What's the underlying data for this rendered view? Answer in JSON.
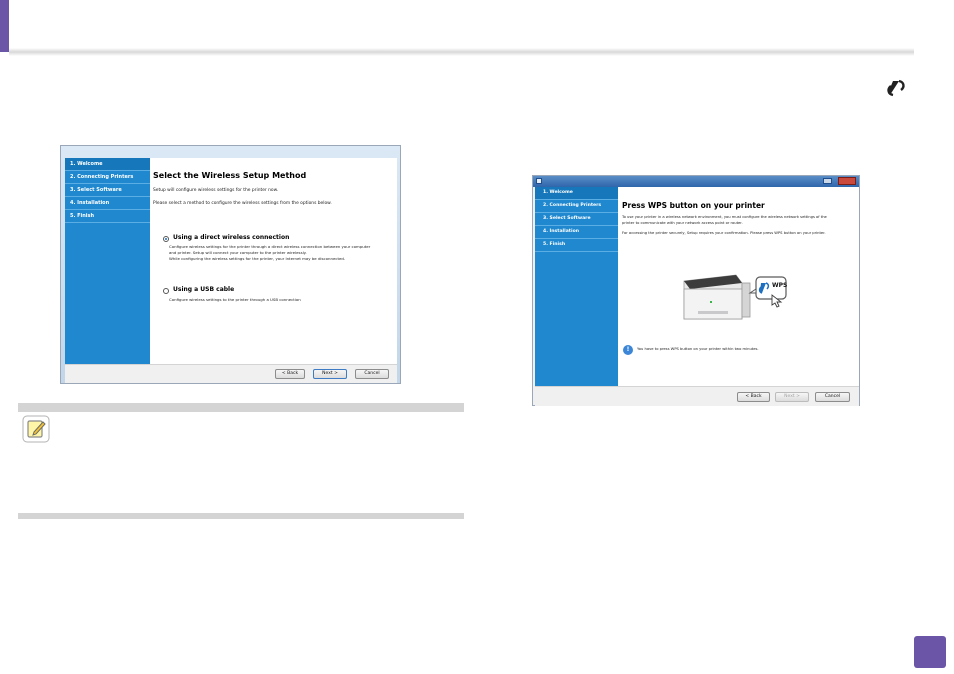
{
  "colors": {
    "accent": "#6b55a6",
    "sidebar": "#1f88cf",
    "sidebar_active": "#1678bb"
  },
  "icons": {
    "header_icon": "wps-icon",
    "note_icon": "note-pencil-icon",
    "printer_image": "printer-with-wps-button"
  },
  "left_dialog": {
    "steps": [
      {
        "label": "1. Welcome",
        "active": true
      },
      {
        "label": "2. Connecting Printers",
        "active": false
      },
      {
        "label": "3. Select Software",
        "active": false
      },
      {
        "label": "4. Installation",
        "active": false
      },
      {
        "label": "5. Finish",
        "active": false
      }
    ],
    "heading": "Select the Wireless Setup Method",
    "intro": "Setup will configure wireless settings for the printer now.",
    "instruction": "Please select a method to configure the wireless settings from the options below.",
    "option1": {
      "label": "Using a direct wireless connection",
      "desc1": "Configure wireless settings for the printer through a direct wireless connection between your computer",
      "desc2": "and printer. Setup will connect your computer to the printer wirelessly.",
      "desc3": "While configuring the wireless settings for the printer, your Internet may be disconnected.",
      "selected": true
    },
    "option2": {
      "label": "Using a USB cable",
      "desc1": "Configure wireless settings to the printer through a USB connection",
      "selected": false
    },
    "buttons": {
      "back": "< Back",
      "next": "Next >",
      "cancel": "Cancel"
    }
  },
  "right_dialog": {
    "steps": [
      {
        "label": "1. Welcome",
        "active": true
      },
      {
        "label": "2. Connecting Printers",
        "active": false
      },
      {
        "label": "3. Select Software",
        "active": false
      },
      {
        "label": "4. Installation",
        "active": false
      },
      {
        "label": "5. Finish",
        "active": false
      }
    ],
    "heading": "Press WPS button on your printer",
    "text1": "To use your printer in a wireless network environment, you must configure the wireless network settings of the",
    "text2": "printer to communicate with your network access point or router.",
    "text3": "For accessing the printer securely, Setup requires your confirmation. Please press WPS button on your printer.",
    "wps_label": "WPS",
    "tip": "You have to press WPS button on your printer within two minutes.",
    "buttons": {
      "back": "< Back",
      "next": "Next >",
      "cancel": "Cancel"
    }
  }
}
